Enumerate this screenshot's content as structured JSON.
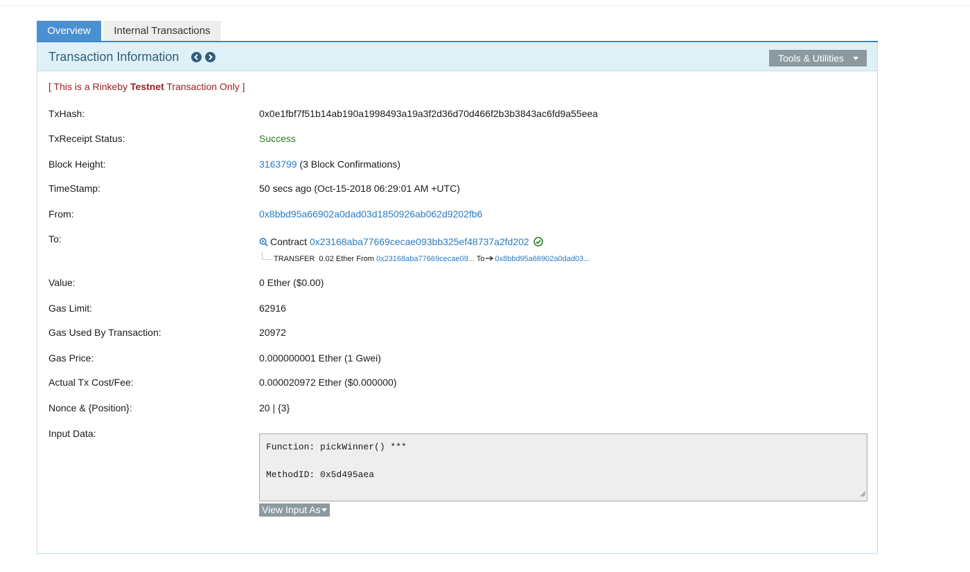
{
  "tabs": {
    "overview": "Overview",
    "internal": "Internal Transactions"
  },
  "panel": {
    "title": "Transaction Information",
    "tools_label": "Tools & Utilities"
  },
  "testnet_note": {
    "prefix": "[ This is a Rinkeby ",
    "bold": "Testnet",
    "suffix": " Transaction Only ]"
  },
  "fields": {
    "txhash": {
      "label": "TxHash:",
      "value": "0x0e1fbf7f51b14ab190a1998493a19a3f2d36d70d466f2b3b3843ac6fd9a55eea"
    },
    "status": {
      "label": "TxReceipt Status:",
      "value": "Success"
    },
    "block": {
      "label": "Block Height:",
      "value": "3163799",
      "confirmations": " (3 Block Confirmations)"
    },
    "timestamp": {
      "label": "TimeStamp:",
      "value": "50 secs ago (Oct-15-2018 06:29:01 AM +UTC)"
    },
    "from": {
      "label": "From:",
      "value": "0x8bbd95a66902a0dad03d1850926ab062d9202fb6"
    },
    "to": {
      "label": "To:",
      "contract_text": "Contract ",
      "contract_address": "0x23168aba77669cecae093bb325ef48737a2fd202",
      "transfer": {
        "type": "TRANSFER",
        "amount": "0.02 Ether From",
        "from": "0x23168aba77669cecae09...",
        "to_word": "To",
        "to": "0x8bbd95a66902a0dad03..."
      }
    },
    "value": {
      "label": "Value:",
      "value": "0 Ether ($0.00)"
    },
    "gas_limit": {
      "label": "Gas Limit:",
      "value": "62916"
    },
    "gas_used": {
      "label": "Gas Used By Transaction:",
      "value": "20972"
    },
    "gas_price": {
      "label": "Gas Price:",
      "value": "0.000000001 Ether (1 Gwei)"
    },
    "tx_fee": {
      "label": "Actual Tx Cost/Fee:",
      "value": "0.000020972 Ether ($0.000000)"
    },
    "nonce": {
      "label": "Nonce & {Position}:",
      "value": "20 | {3}"
    },
    "input": {
      "label": "Input Data:",
      "line1": "Function: pickWinner() ***",
      "line2": "MethodID: 0x5d495aea",
      "view_as": "View Input As"
    }
  },
  "colors": {
    "accent": "#4a90d0",
    "link": "#2a7bbf",
    "success": "#2b7a1e",
    "testnet": "#9b1c1c",
    "header_bg": "#dff0f7"
  }
}
